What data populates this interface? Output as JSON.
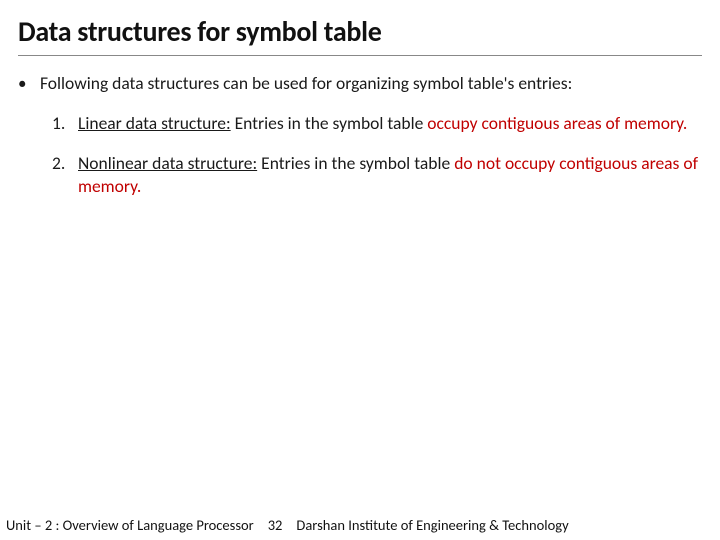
{
  "title": "Data structures for symbol table",
  "bullet_intro": "Following data structures can be used for organizing symbol table's entries:",
  "items": [
    {
      "num": "1.",
      "label": "Linear data structure:",
      "rest_before": " Entries in the symbol table ",
      "emph": "occupy contiguous areas of memory.",
      "rest_after": ""
    },
    {
      "num": "2.",
      "label": "Nonlinear data structure:",
      "rest_before": " Entries in the symbol table ",
      "emph": "do not occupy contiguous areas of memory.",
      "rest_after": ""
    }
  ],
  "footer": {
    "left": "Unit – 2  : Overview of Language Processor",
    "page": "32",
    "right": "Darshan Institute of Engineering & Technology"
  }
}
